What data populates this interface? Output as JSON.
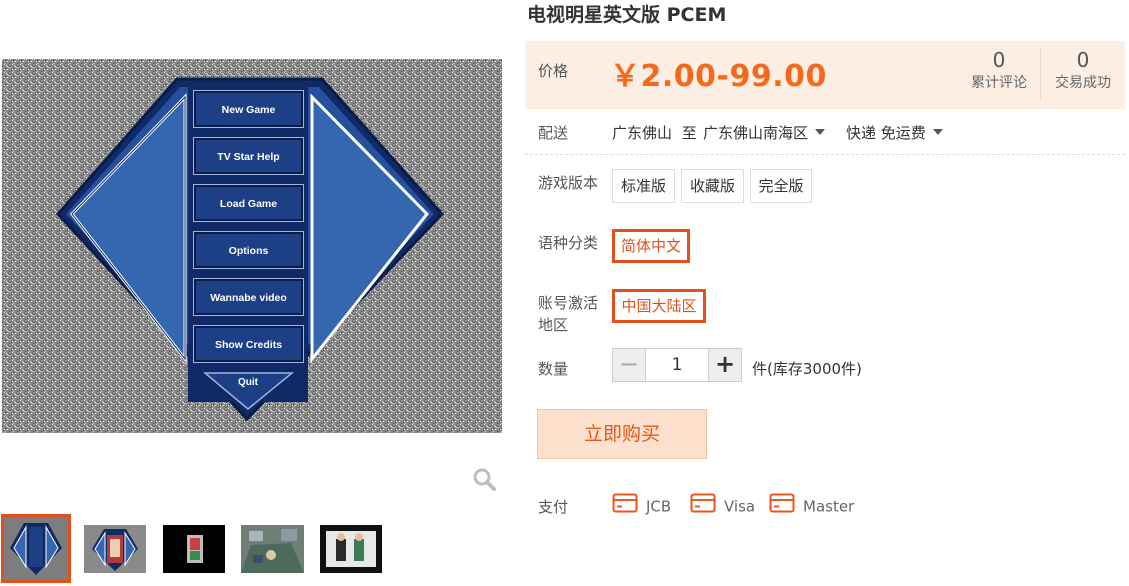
{
  "product": {
    "title": "电视明星英文版 PCEM"
  },
  "game_menu": {
    "buttons": [
      "New Game",
      "TV Star Help",
      "Load Game",
      "Options",
      "Wannabe video",
      "Show Credits"
    ],
    "quit": "Quit"
  },
  "price": {
    "label": "价格",
    "value": "￥2.00-99.00",
    "reviews_count": "0",
    "reviews_label": "累计评论",
    "trades_count": "0",
    "trades_label": "交易成功"
  },
  "shipping": {
    "label": "配送",
    "from": "广东佛山",
    "to_word": "至",
    "to": "广东佛山南海区",
    "method": "快递 免运费"
  },
  "version": {
    "label": "游戏版本",
    "options": [
      "标准版",
      "收藏版",
      "完全版"
    ]
  },
  "language": {
    "label": "语种分类",
    "options": [
      "简体中文"
    ]
  },
  "region": {
    "label_line1": "账号激活",
    "label_line2": "地区",
    "options": [
      "中国大陆区"
    ]
  },
  "quantity": {
    "label": "数量",
    "minus": "−",
    "value": "1",
    "plus": "+",
    "stock": "件(库存3000件)"
  },
  "buy": {
    "label": "立即购买"
  },
  "payment": {
    "label": "支付",
    "methods": [
      "JCB",
      "Visa",
      "Master"
    ]
  },
  "colors": {
    "accent": "#e4501c",
    "price": "#f56a1a",
    "price_bg": "#fdeee4",
    "menu_blue": "#2f5fa6",
    "menu_dark": "#0f2a66"
  }
}
